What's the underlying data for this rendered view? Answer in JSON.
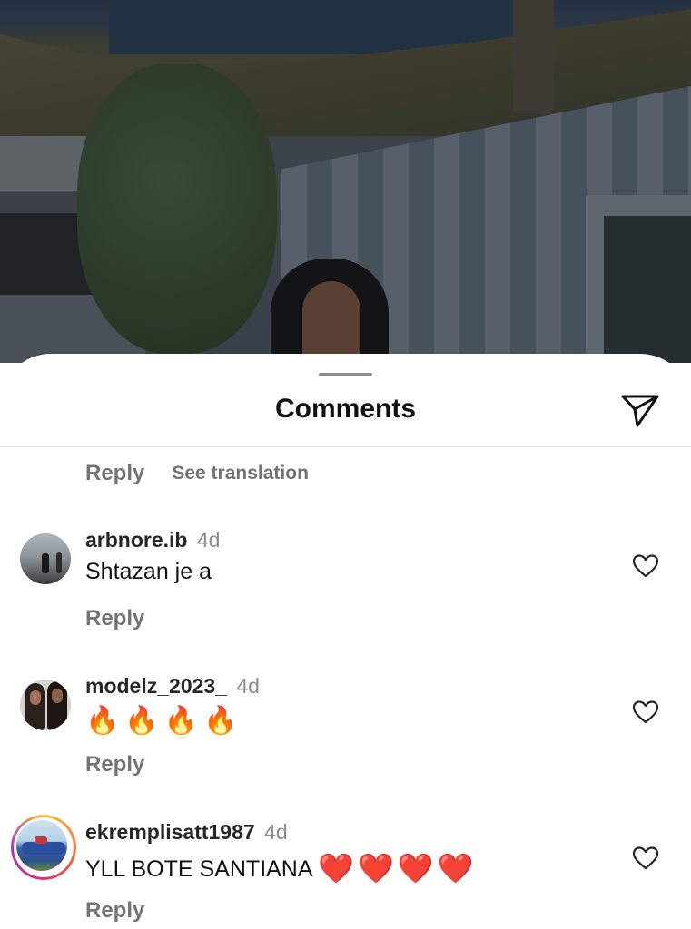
{
  "sheet": {
    "title": "Comments",
    "share_icon": "paper-plane-icon"
  },
  "top_reply": {
    "reply_label": "Reply",
    "see_translation_label": "See translation"
  },
  "comments": [
    {
      "username": "arbnore.ib",
      "time": "4d",
      "text": "Shtazan je a",
      "reply_label": "Reply",
      "like_icon": "heart-outline-icon"
    },
    {
      "username": "modelz_2023_",
      "time": "4d",
      "text": "🔥🔥🔥🔥",
      "reply_label": "Reply",
      "like_icon": "heart-outline-icon"
    },
    {
      "username": "ekremplisatt1987",
      "time": "4d",
      "text": "YLL BOTE SANTIANA",
      "emoji": "❤️❤️❤️❤️",
      "reply_label": "Reply",
      "like_icon": "heart-outline-icon",
      "has_story_ring": true
    }
  ]
}
